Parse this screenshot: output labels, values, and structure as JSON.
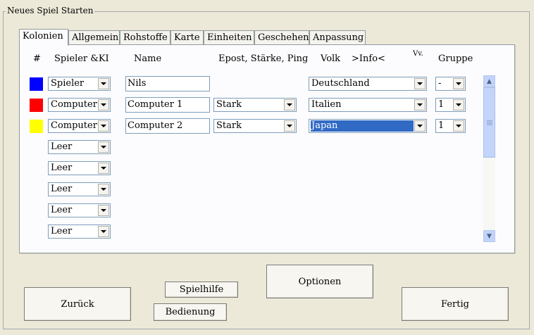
{
  "window": {
    "title": "Neues Spiel Starten"
  },
  "tabs": [
    {
      "label": "Kolonien",
      "active": true
    },
    {
      "label": "Allgemein"
    },
    {
      "label": "Rohstoffe"
    },
    {
      "label": "Karte"
    },
    {
      "label": "Einheiten"
    },
    {
      "label": "Geschehen"
    },
    {
      "label": "Anpassung"
    }
  ],
  "columns": {
    "num": "#",
    "player": "Spieler &KI",
    "name": "Name",
    "epost": "Epost, Stärke, Ping",
    "volk": "Volk",
    "info": ">Info<",
    "vv": "Vv.",
    "gruppe": "Gruppe"
  },
  "rows": [
    {
      "color": "#0000ff",
      "player": "Spieler",
      "name": "Nils",
      "strength": "",
      "volk": "Deutschland",
      "gruppe": "-"
    },
    {
      "color": "#ff0000",
      "player": "Computer",
      "name": "Computer 1",
      "strength": "Stark",
      "volk": "Italien",
      "gruppe": "1"
    },
    {
      "color": "#ffff00",
      "player": "Computer",
      "name": "Computer 2",
      "strength": "Stark",
      "volk": "Japan",
      "gruppe": "1",
      "volk_selected": true
    },
    {
      "player": "Leer"
    },
    {
      "player": "Leer"
    },
    {
      "player": "Leer"
    },
    {
      "player": "Leer"
    },
    {
      "player": "Leer"
    }
  ],
  "buttons": {
    "back": "Zurück",
    "help": "Spielhilfe",
    "controls": "Bedienung",
    "options": "Optionen",
    "finish": "Fertig"
  }
}
